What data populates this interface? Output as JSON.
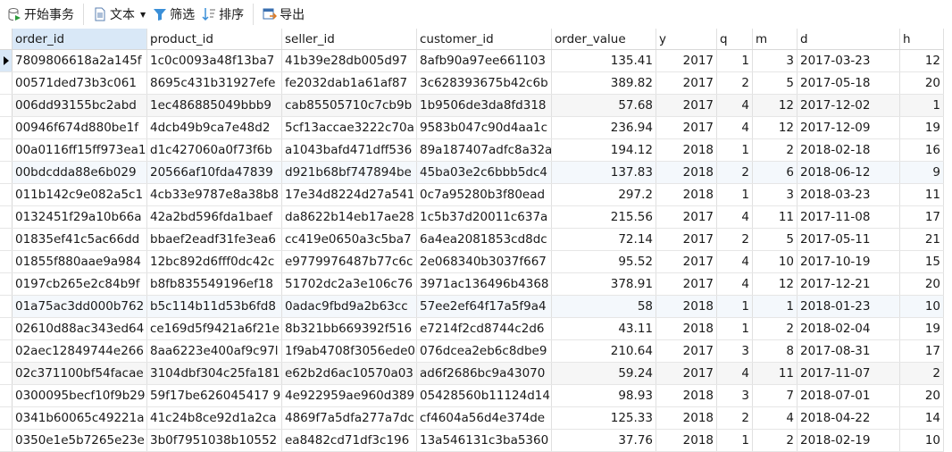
{
  "toolbar": {
    "begin_transaction": "开始事务",
    "text": "文本",
    "filter": "筛选",
    "sort": "排序",
    "export": "导出"
  },
  "columns": [
    "order_id",
    "product_id",
    "seller_id",
    "customer_id",
    "order_value",
    "y",
    "q",
    "m",
    "d",
    "h"
  ],
  "rows": [
    [
      "7809806618a2a145f",
      "1c0c0093a48f13ba7",
      "41b39e28db005d97",
      "8afb90a97ee661103",
      "135.41",
      "2017",
      "1",
      "3",
      "2017-03-23",
      "12"
    ],
    [
      "00571ded73b3c061",
      "8695c431b31927efe",
      "fe2032dab1a61af87",
      "3c628393675b42c6b",
      "389.82",
      "2017",
      "2",
      "5",
      "2017-05-18",
      "20"
    ],
    [
      "006dd93155bc2abd",
      "1ec486885049bbb9",
      "cab85505710c7cb9b",
      "1b9506de3da8fd318",
      "57.68",
      "2017",
      "4",
      "12",
      "2017-12-02",
      "1"
    ],
    [
      "00946f674d880be1f",
      "4dcb49b9ca7e48d2",
      "5cf13accae3222c70a",
      "9583b047c90d4aa1c",
      "236.94",
      "2017",
      "4",
      "12",
      "2017-12-09",
      "19"
    ],
    [
      "00a0116ff15ff973ea1",
      "d1c427060a0f73f6b",
      "a1043bafd471dff536",
      "89a187407adfc8a32a",
      "194.12",
      "2018",
      "1",
      "2",
      "2018-02-18",
      "16"
    ],
    [
      "00bdcdda88e6b029",
      "20566af10fda47839",
      "d921b68bf747894be",
      "45ba03e2c6bbb5dc4",
      "137.83",
      "2018",
      "2",
      "6",
      "2018-06-12",
      "9"
    ],
    [
      "011b142c9e082a5c1",
      "4cb33e9787e8a38b8",
      "17e34d8224d27a541",
      "0c7a95280b3f80ead",
      "297.2",
      "2018",
      "1",
      "3",
      "2018-03-23",
      "11"
    ],
    [
      "0132451f29a10b66a",
      "42a2bd596fda1baef",
      "da8622b14eb17ae28",
      "1c5b37d20011c637a",
      "215.56",
      "2017",
      "4",
      "11",
      "2017-11-08",
      "17"
    ],
    [
      "01835ef41c5ac66dd",
      "bbaef2eadf31fe3ea6",
      "cc419e0650a3c5ba7",
      "6a4ea2081853cd8dc",
      "72.14",
      "2017",
      "2",
      "5",
      "2017-05-11",
      "21"
    ],
    [
      "01855f880aae9a984",
      "12bc892d6fff0dc42c",
      "e9779976487b77c6c",
      "2e068340b3037f667",
      "95.52",
      "2017",
      "4",
      "10",
      "2017-10-19",
      "15"
    ],
    [
      "0197cb265e2c84b9f",
      "b8fb835549196ef18",
      "51702dc2a3e106c76",
      "3971ac136496b4368",
      "378.91",
      "2017",
      "4",
      "12",
      "2017-12-21",
      "20"
    ],
    [
      "01a75ac3dd000b762",
      "b5c114b11d53b6fd8",
      "0adac9fbd9a2b63cc",
      "57ee2ef64f17a5f9a4",
      "58",
      "2018",
      "1",
      "1",
      "2018-01-23",
      "10"
    ],
    [
      "02610d88ac343ed64",
      "ce169d5f9421a6f21e",
      "8b321bb669392f516",
      "e7214f2cd8744c2d6",
      "43.11",
      "2018",
      "1",
      "2",
      "2018-02-04",
      "19"
    ],
    [
      "02aec12849744e266",
      "8aa6223e400af9c97l",
      "1f9ab4708f3056ede0",
      "076dcea2eb6c8dbe9",
      "210.64",
      "2017",
      "3",
      "8",
      "2017-08-31",
      "17"
    ],
    [
      "02c371100bf54facae",
      "3104dbf304c25fa181",
      "e62b2d6ac10570a03",
      "ad6f2686bc9a43070",
      "59.24",
      "2017",
      "4",
      "11",
      "2017-11-07",
      "2"
    ],
    [
      "0300095becf10f9b29",
      "59f17be626045417 9",
      "4e922959ae960d389",
      "05428560b11124d14",
      "98.93",
      "2018",
      "3",
      "7",
      "2018-07-01",
      "20"
    ],
    [
      "0341b60065c49221a",
      "41c24b8ce92d1a2ca",
      "4869f7a5dfa277a7dc",
      "cf4604a56d4e374de",
      "125.33",
      "2018",
      "2",
      "4",
      "2018-04-22",
      "14"
    ],
    [
      "0350e1e5b7265e23e",
      "3b0f7951038b10552",
      "ea8482cd71df3c196",
      "13a546131c3ba5360",
      "37.76",
      "2018",
      "1",
      "2",
      "2018-02-19",
      "10"
    ]
  ]
}
